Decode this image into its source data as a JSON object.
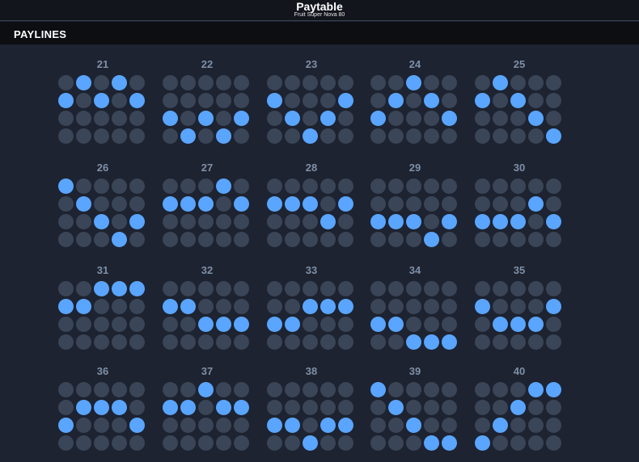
{
  "header": {
    "title": "Paytable",
    "subtitle": "Fruit Super Nova 80"
  },
  "section": {
    "title": "PAYLINES"
  },
  "colors": {
    "inactive_dot": "#3a4557",
    "active_dot": "#5aa5ff",
    "number": "#7f8fa7"
  },
  "paylines": [
    {
      "number": "21",
      "rows": [
        1,
        0,
        1,
        0,
        1
      ]
    },
    {
      "number": "22",
      "rows": [
        2,
        3,
        2,
        3,
        2
      ]
    },
    {
      "number": "23",
      "rows": [
        1,
        2,
        3,
        2,
        1
      ]
    },
    {
      "number": "24",
      "rows": [
        2,
        1,
        0,
        1,
        2
      ]
    },
    {
      "number": "25",
      "rows": [
        1,
        0,
        1,
        2,
        3
      ]
    },
    {
      "number": "26",
      "rows": [
        0,
        1,
        2,
        3,
        2
      ]
    },
    {
      "number": "27",
      "rows": [
        1,
        1,
        1,
        0,
        1
      ]
    },
    {
      "number": "28",
      "rows": [
        1,
        1,
        1,
        2,
        1
      ]
    },
    {
      "number": "29",
      "rows": [
        2,
        2,
        2,
        3,
        2
      ]
    },
    {
      "number": "30",
      "rows": [
        2,
        2,
        2,
        1,
        2
      ]
    },
    {
      "number": "31",
      "rows": [
        1,
        1,
        0,
        0,
        0
      ]
    },
    {
      "number": "32",
      "rows": [
        1,
        1,
        2,
        2,
        2
      ]
    },
    {
      "number": "33",
      "rows": [
        2,
        2,
        1,
        1,
        1
      ]
    },
    {
      "number": "34",
      "rows": [
        2,
        2,
        3,
        3,
        3
      ]
    },
    {
      "number": "35",
      "rows": [
        1,
        2,
        2,
        2,
        1
      ]
    },
    {
      "number": "36",
      "rows": [
        2,
        1,
        1,
        1,
        2
      ]
    },
    {
      "number": "37",
      "rows": [
        1,
        1,
        0,
        1,
        1
      ]
    },
    {
      "number": "38",
      "rows": [
        2,
        2,
        3,
        2,
        2
      ]
    },
    {
      "number": "39",
      "rows": [
        0,
        1,
        2,
        3,
        3
      ]
    },
    {
      "number": "40",
      "rows": [
        3,
        2,
        1,
        0,
        0
      ]
    }
  ]
}
